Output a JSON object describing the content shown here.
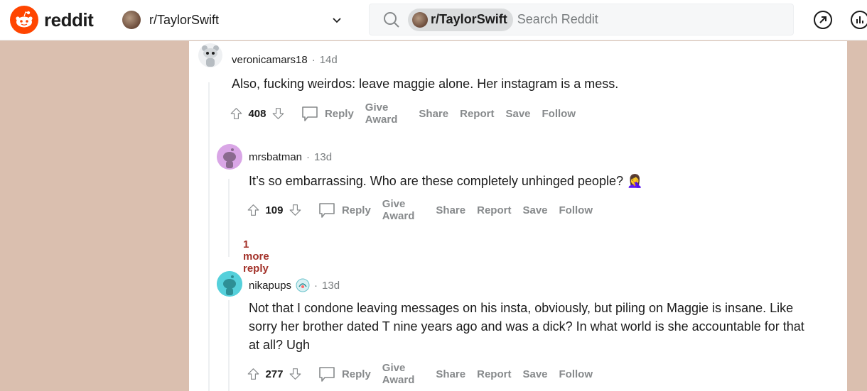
{
  "header": {
    "logo_text": "reddit",
    "community": "r/TaylorSwift",
    "search_chip": "r/TaylorSwift",
    "search_placeholder": "Search Reddit"
  },
  "comments": [
    {
      "author": "veronicamars18",
      "time": "14d",
      "body": "Also, fucking weirdos: leave maggie alone. Her instagram is a mess.",
      "score": "408"
    },
    {
      "author": "mrsbatman",
      "time": "13d",
      "body": "It’s so embarrassing. Who are these completely unhinged people? 🤦‍♀️",
      "score": "109"
    },
    {
      "author": "nikapups",
      "time": "13d",
      "body": "Not that I condone leaving messages on his insta, obviously, but piling on Maggie is insane. Like sorry her brother dated T nine years ago and was a dick? In what world is she accountable for that at all? Ugh",
      "score": "277"
    }
  ],
  "actions": {
    "reply": "Reply",
    "give_award": "Give Award",
    "share": "Share",
    "report": "Report",
    "save": "Save",
    "follow": "Follow"
  },
  "more_replies_label": "1 more reply",
  "colors": {
    "background": "#dabfaf",
    "brand": "#ff4500",
    "more_replies": "#a3322a"
  }
}
